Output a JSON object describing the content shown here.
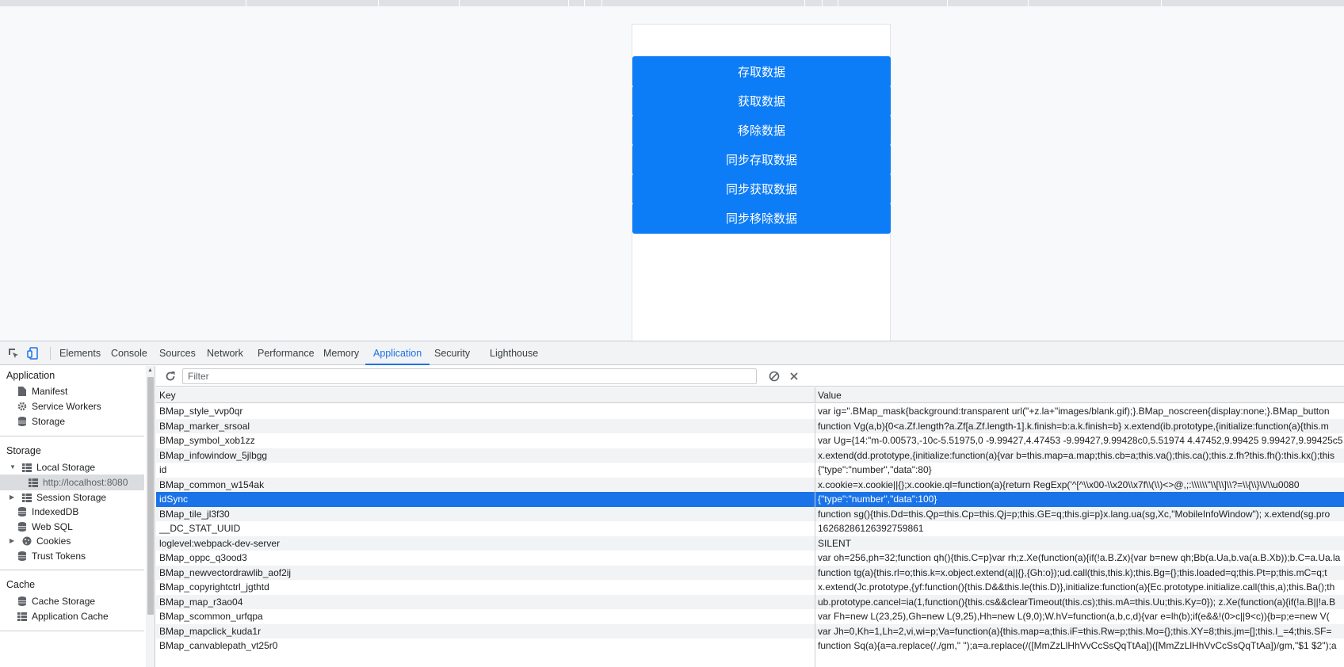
{
  "page": {
    "buttons": [
      {
        "label": "存取数据"
      },
      {
        "label": "获取数据"
      },
      {
        "label": "移除数据"
      },
      {
        "label": "同步存取数据"
      },
      {
        "label": "同步获取数据"
      },
      {
        "label": "同步移除数据"
      }
    ]
  },
  "devtools": {
    "tabs": [
      {
        "label": "Elements"
      },
      {
        "label": "Console"
      },
      {
        "label": "Sources"
      },
      {
        "label": "Network"
      },
      {
        "label": "Performance"
      },
      {
        "label": "Memory"
      },
      {
        "label": "Application",
        "active": true
      },
      {
        "label": "Security"
      },
      {
        "label": "Lighthouse"
      }
    ],
    "accent_color": "#1a73e8"
  },
  "sidebar": {
    "application_header": "Application",
    "application_items": [
      {
        "label": "Manifest",
        "icon": "document-icon"
      },
      {
        "label": "Service Workers",
        "icon": "gear-icon"
      },
      {
        "label": "Storage",
        "icon": "database-icon"
      }
    ],
    "storage_header": "Storage",
    "storage_items": [
      {
        "label": "Local Storage",
        "icon": "grid-icon",
        "expanded": true
      },
      {
        "label": "http://localhost:8080",
        "icon": "grid-icon",
        "selected": true
      },
      {
        "label": "Session Storage",
        "icon": "grid-icon",
        "expanded": false
      },
      {
        "label": "IndexedDB",
        "icon": "database-icon"
      },
      {
        "label": "Web SQL",
        "icon": "database-icon"
      },
      {
        "label": "Cookies",
        "icon": "cookie-icon",
        "expanded": false
      },
      {
        "label": "Trust Tokens",
        "icon": "database-icon"
      }
    ],
    "cache_header": "Cache",
    "cache_items": [
      {
        "label": "Cache Storage",
        "icon": "database-icon"
      },
      {
        "label": "Application Cache",
        "icon": "grid-icon"
      }
    ]
  },
  "storage_view": {
    "filter_placeholder": "Filter",
    "columns": {
      "key": "Key",
      "value": "Value"
    },
    "rows": [
      {
        "key": "BMap_style_vvp0qr",
        "value": "var ig=\".BMap_mask{background:transparent url(\"+z.la+\"images/blank.gif);}.BMap_noscreen{display:none;}.BMap_button"
      },
      {
        "key": "BMap_marker_srsoal",
        "value": "function Vg(a,b){0<a.Zf.length?a.Zf[a.Zf.length-1].k.finish=b:a.k.finish=b} x.extend(ib.prototype,{initialize:function(a){this.m"
      },
      {
        "key": "BMap_symbol_xob1zz",
        "value": "var Ug={14:\"m-0.00573,-10c-5.51975,0 -9.99427,4.47453 -9.99427,9.99428c0,5.51974 4.47452,9.99425 9.99427,9.99425c5"
      },
      {
        "key": "BMap_infowindow_5jlbgg",
        "value": "x.extend(dd.prototype,{initialize:function(a){var b=this.map=a.map;this.cb=a;this.va();this.ca();this.z.fh?this.fh():this.kx();this"
      },
      {
        "key": "id",
        "value": "{\"type\":\"number\",\"data\":80}"
      },
      {
        "key": "BMap_common_w154ak",
        "value": "x.cookie=x.cookie||{};x.cookie.ql=function(a){return RegExp('^[^\\\\x00-\\\\x20\\\\x7f\\\\(\\\\)<>@,;:\\\\\\\\\\\\\"\\\\[\\\\]\\\\?=\\\\{\\\\}\\\\/\\\\u0080"
      },
      {
        "key": "idSync",
        "value": "{\"type\":\"number\",\"data\":100}",
        "selected": true
      },
      {
        "key": "BMap_tile_jl3f30",
        "value": "function sg(){this.Dd=this.Qp=this.Cp=this.Qj=p;this.GE=q;this.gi=p}x.lang.ua(sg,Xc,\"MobileInfoWindow\"); x.extend(sg.pro"
      },
      {
        "key": "__DC_STAT_UUID",
        "value": "16268286126392759861"
      },
      {
        "key": "loglevel:webpack-dev-server",
        "value": "SILENT"
      },
      {
        "key": "BMap_oppc_q3ood3",
        "value": "var oh=256,ph=32;function qh(){this.C=p}var rh;z.Xe(function(a){if(!a.B.Zx){var b=new qh;Bb(a.Ua,b.va(a.B.Xb));b.C=a.Ua.la"
      },
      {
        "key": "BMap_newvectordrawlib_aof2ij",
        "value": "function tg(a){this.rl=o;this.k=x.object.extend(a||{},{Gh:o});ud.call(this,this.k);this.Bg={};this.loaded=q;this.Pt=p;this.mC=q;t"
      },
      {
        "key": "BMap_copyrightctrl_jgthtd",
        "value": "x.extend(Jc.prototype,{yf:function(){this.D&&this.le(this.D)},initialize:function(a){Ec.prototype.initialize.call(this,a);this.Ba();th"
      },
      {
        "key": "BMap_map_r3ao04",
        "value": "ub.prototype.cancel=ia(1,function(){this.cs&&clearTimeout(this.cs);this.mA=this.Uu;this.Ky=0}); z.Xe(function(a){if(!a.B||!a.B"
      },
      {
        "key": "BMap_scommon_urfqpa",
        "value": "var Fh=new L(23,25),Gh=new L(9,25),Hh=new L(9,0);W.hV=function(a,b,c,d){var e=lh(b);if(e&&!(0>c||9<c)){b=p;e=new V("
      },
      {
        "key": "BMap_mapclick_kuda1r",
        "value": "var Jh=0,Kh=1,Lh=2,vi,wi=p;Va=function(a){this.map=a;this.iF=this.Rw=p;this.Mo={};this.XY=8;this.jm=[];this.I_=4;this.SF="
      },
      {
        "key": "BMap_canvablepath_vt25r0",
        "value": "function Sq(a){a=a.replace(/,/gm,\" \");a=a.replace(/([MmZzLlHhVvCcSsQqTtAa])([MmZzLlHhVvCcSsQqTtAa])/gm,\"$1 $2\");a"
      }
    ]
  }
}
